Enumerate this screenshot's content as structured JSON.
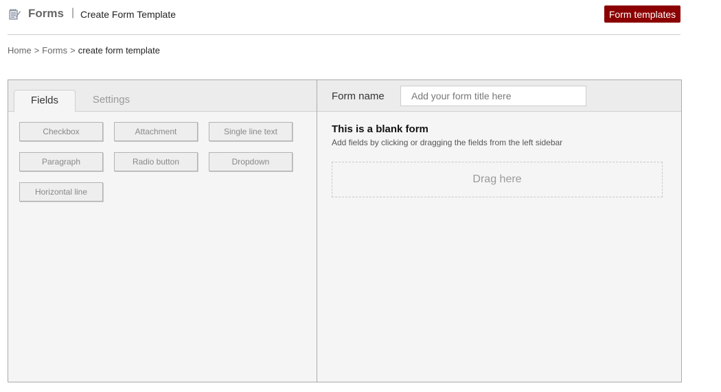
{
  "header": {
    "app_title": "Forms",
    "separator": "|",
    "page_title": "Create Form Template",
    "templates_button": "Form templates",
    "icon": "notepad-pencil-icon",
    "accent_color": "#8b0000"
  },
  "breadcrumb": {
    "items": [
      "Home",
      "Forms",
      "create form template"
    ],
    "separator": ">"
  },
  "left_panel": {
    "tabs": [
      {
        "label": "Fields",
        "active": true
      },
      {
        "label": "Settings",
        "active": false
      }
    ],
    "fields": [
      "Checkbox",
      "Attachment",
      "Single line text",
      "Paragraph",
      "Radio button",
      "Dropdown",
      "Horizontal line"
    ]
  },
  "right_panel": {
    "form_name_label": "Form name",
    "form_name_placeholder": "Add your form title here",
    "blank_title": "This is a blank form",
    "blank_hint": "Add fields by clicking or dragging the fields from the left sidebar",
    "dropzone_text": "Drag here"
  }
}
